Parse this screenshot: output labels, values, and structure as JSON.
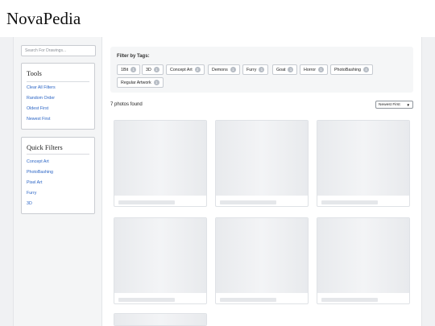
{
  "site": {
    "title": "NovaPedia"
  },
  "search": {
    "placeholder": "Search For Drawings..."
  },
  "tools": {
    "title": "Tools",
    "links": [
      "Clear All Filters",
      "Random Order",
      "Oldest First",
      "Newest First"
    ]
  },
  "quick_filters": {
    "title": "Quick Filters",
    "links": [
      "Concept Art",
      "PhotoBashing",
      "Pixel Art",
      "Furry",
      "3D"
    ]
  },
  "filter": {
    "title": "Filter by Tags:",
    "tags": [
      {
        "label": "1Bit",
        "count": "1"
      },
      {
        "label": "3D",
        "count": "1"
      },
      {
        "label": "Concept Art",
        "count": "2"
      },
      {
        "label": "Demons",
        "count": "1"
      },
      {
        "label": "Furry",
        "count": "1"
      },
      {
        "label": "Goat",
        "count": "1"
      },
      {
        "label": "Horror",
        "count": "1"
      },
      {
        "label": "PhotoBashing",
        "count": "4"
      },
      {
        "label": "Regular Artwork",
        "count": "1"
      }
    ]
  },
  "results": {
    "count_text": "7 photos found"
  },
  "sort": {
    "selected": "Newest First",
    "chevron_icon": "chevron-down-icon"
  },
  "gallery": {
    "photo_count": 7
  }
}
